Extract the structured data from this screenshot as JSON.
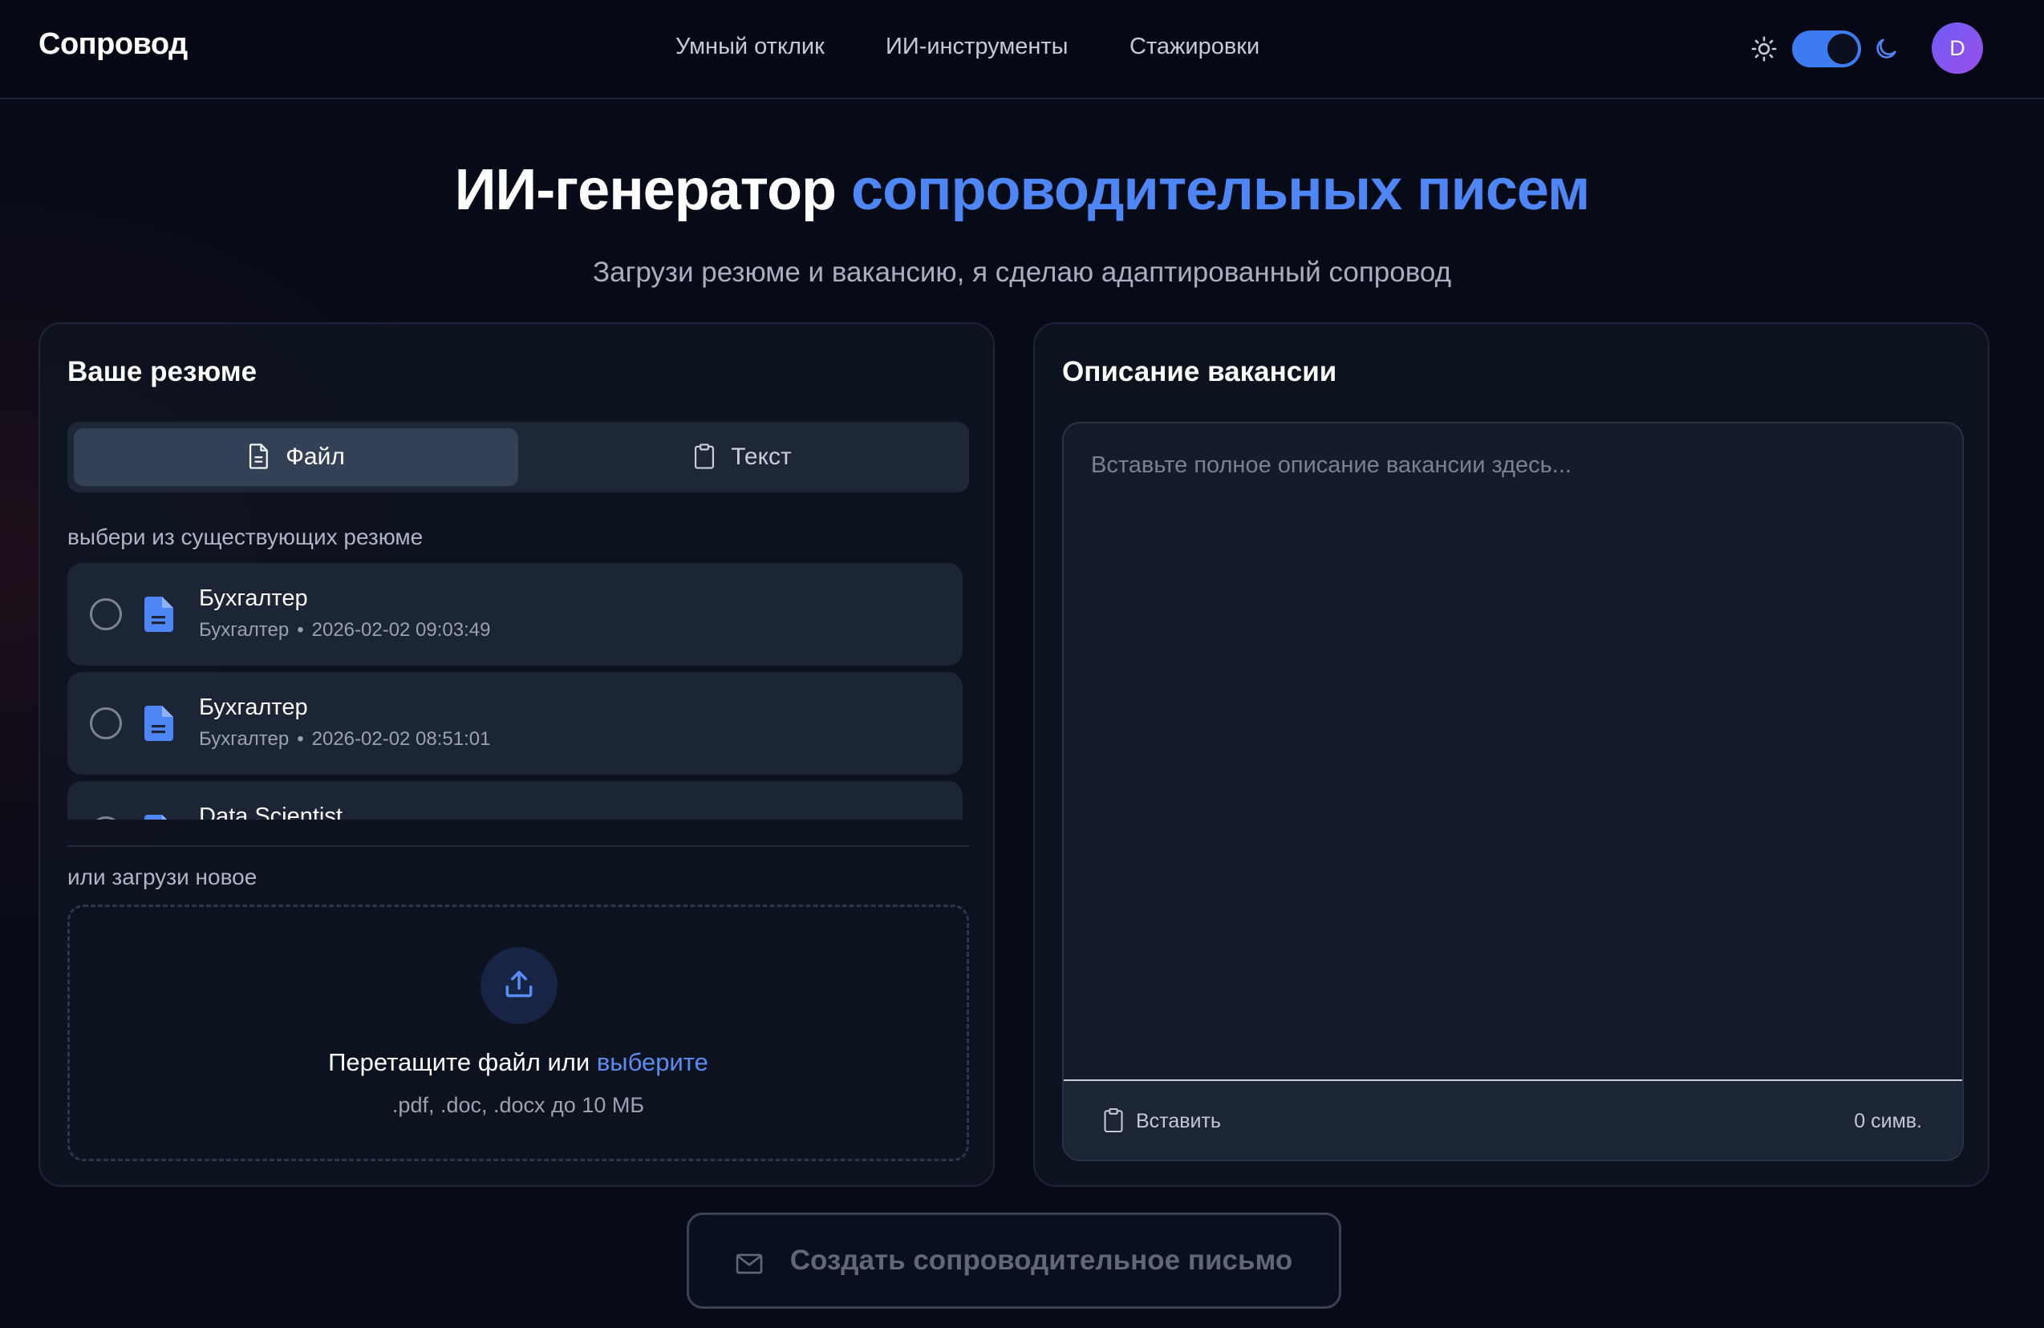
{
  "header": {
    "logo": "Сопровод",
    "nav": [
      "Умный отклик",
      "ИИ-инструменты",
      "Стажировки"
    ],
    "theme": {
      "mode": "dark",
      "sun_icon": "sun-icon",
      "moon_icon": "moon-icon"
    },
    "avatar_initial": "D"
  },
  "hero": {
    "title_main": "ИИ-генератор ",
    "title_accent": "сопроводительных писем",
    "subtitle": "Загрузи резюме и вакансию, я сделаю адаптированный сопровод"
  },
  "resume_card": {
    "title": "Ваше резюме",
    "tabs": [
      {
        "label": "Файл",
        "icon": "file-icon",
        "active": true
      },
      {
        "label": "Текст",
        "icon": "clipboard-icon",
        "active": false
      }
    ],
    "existing_label": "выбери из существующих резюме",
    "items": [
      {
        "title": "Бухгалтер",
        "subtitle": "Бухгалтер",
        "date": "2026-02-02 09:03:49"
      },
      {
        "title": "Бухгалтер",
        "subtitle": "Бухгалтер",
        "date": "2026-02-02 08:51:01"
      },
      {
        "title": "Data Scientist",
        "subtitle": "",
        "date": ""
      }
    ],
    "separator": "•",
    "upload_label": "или загрузи новое",
    "dropzone": {
      "text": "Перетащите файл или ",
      "link": "выберите",
      "hint": ".pdf, .doc, .docx до 10 МБ"
    }
  },
  "vacancy_card": {
    "title": "Описание вакансии",
    "placeholder": "Вставьте полное описание вакансии здесь...",
    "value": "",
    "paste_label": "Вставить",
    "char_count": "0 симв."
  },
  "create_button": {
    "label": "Создать сопроводительное письмо",
    "icon": "mail-icon",
    "enabled": false
  },
  "colors": {
    "accent": "#4f86f5",
    "background": "#070b17",
    "card": "#0e1321",
    "avatar": "#7b55f0"
  }
}
